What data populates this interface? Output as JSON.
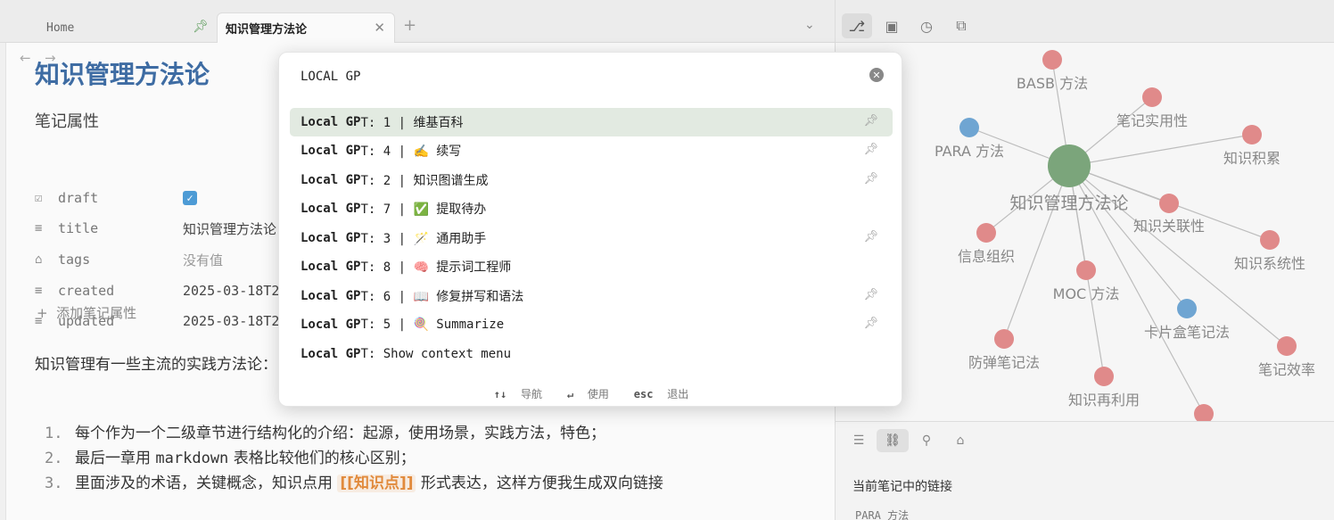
{
  "tabs": {
    "home_label": "Home",
    "active_label": "知识管理方法论",
    "new_tab": "+",
    "dropdown": "⌄"
  },
  "editor": {
    "title": "知识管理方法论",
    "properties_heading": "笔记属性",
    "properties": [
      {
        "key": "draft",
        "icon": "checkbox-icon",
        "value": "",
        "checked": true
      },
      {
        "key": "title",
        "icon": "text-icon",
        "value": "知识管理方法论"
      },
      {
        "key": "tags",
        "icon": "tag-icon",
        "value": "没有值"
      },
      {
        "key": "created",
        "icon": "text-icon",
        "value": "2025-03-18T2"
      },
      {
        "key": "updated",
        "icon": "text-icon",
        "value": "2025-03-18T2"
      }
    ],
    "add_property": "添加笔记属性",
    "intro": "知识管理有一些主流的实践方法论：PARA，BASB，MOC，卡片盒笔记，防弹笔记",
    "list": [
      {
        "num": "1.",
        "text": "每个作为一个二级章节进行结构化的介绍：起源，使用场景，实践方法，特色；"
      },
      {
        "num": "2.",
        "text_a": "最后一章用 ",
        "text_mono": "markdown",
        "text_b": " 表格比较他们的核心区别；"
      },
      {
        "num": "3.",
        "text_a": "里面涉及的术语，关键概念，知识点用 ",
        "wikilink": "[[知识点]]",
        "text_b": " 形式表达，这样方便我生成双向链接"
      }
    ]
  },
  "palette": {
    "query": "LOCAL GP",
    "commands": [
      {
        "prefix": "Local GP",
        "rest": "T: 1 | 维基百科",
        "pinned": true,
        "selected": true
      },
      {
        "prefix": "Local GP",
        "rest": "T: 4 | ✍️  续写",
        "pinned": true
      },
      {
        "prefix": "Local GP",
        "rest": "T: 2 | 知识图谱生成",
        "pinned": true
      },
      {
        "prefix": "Local GP",
        "rest": "T: 7 | ✅  提取待办",
        "pinned": false
      },
      {
        "prefix": "Local GP",
        "rest": "T: 3 | 🪄  通用助手",
        "pinned": true
      },
      {
        "prefix": "Local GP",
        "rest": "T: 8 | 🧠  提示词工程师",
        "pinned": false
      },
      {
        "prefix": "Local GP",
        "rest": "T: 6 | 📖  修复拼写和语法",
        "pinned": true
      },
      {
        "prefix": "Local GP",
        "rest": "T: 5 | 🍭  Summarize",
        "pinned": true
      },
      {
        "prefix": "Local GP",
        "rest": "T: Show context menu",
        "pinned": false
      }
    ],
    "footer": {
      "nav_keys": "↑↓",
      "nav_label": "导航",
      "use_keys": "↵",
      "use_label": "使用",
      "esc_keys": "esc",
      "esc_label": "退出"
    }
  },
  "graph": {
    "center": "知识管理方法论",
    "nodes": [
      {
        "label": "BASB 方法",
        "color": "#e08a8a"
      },
      {
        "label": "笔记实用性",
        "color": "#e08a8a"
      },
      {
        "label": "PARA 方法",
        "color": "#6fa5d2"
      },
      {
        "label": "知识积累",
        "color": "#e08a8a"
      },
      {
        "label": "知识关联性",
        "color": "#e08a8a"
      },
      {
        "label": "信息组织",
        "color": "#e08a8a"
      },
      {
        "label": "知识系统性",
        "color": "#e08a8a"
      },
      {
        "label": "MOC 方法",
        "color": "#e08a8a"
      },
      {
        "label": "卡片盒笔记法",
        "color": "#6fa5d2"
      },
      {
        "label": "防弹笔记法",
        "color": "#e08a8a"
      },
      {
        "label": "笔记效率",
        "color": "#e08a8a"
      },
      {
        "label": "知识再利用",
        "color": "#e08a8a"
      },
      {
        "label": "",
        "color": "#e08a8a"
      }
    ],
    "center_color": "#7ba57b"
  },
  "bottom_panel": {
    "title": "当前笔记中的链接",
    "first_link": "PARA 方法"
  }
}
